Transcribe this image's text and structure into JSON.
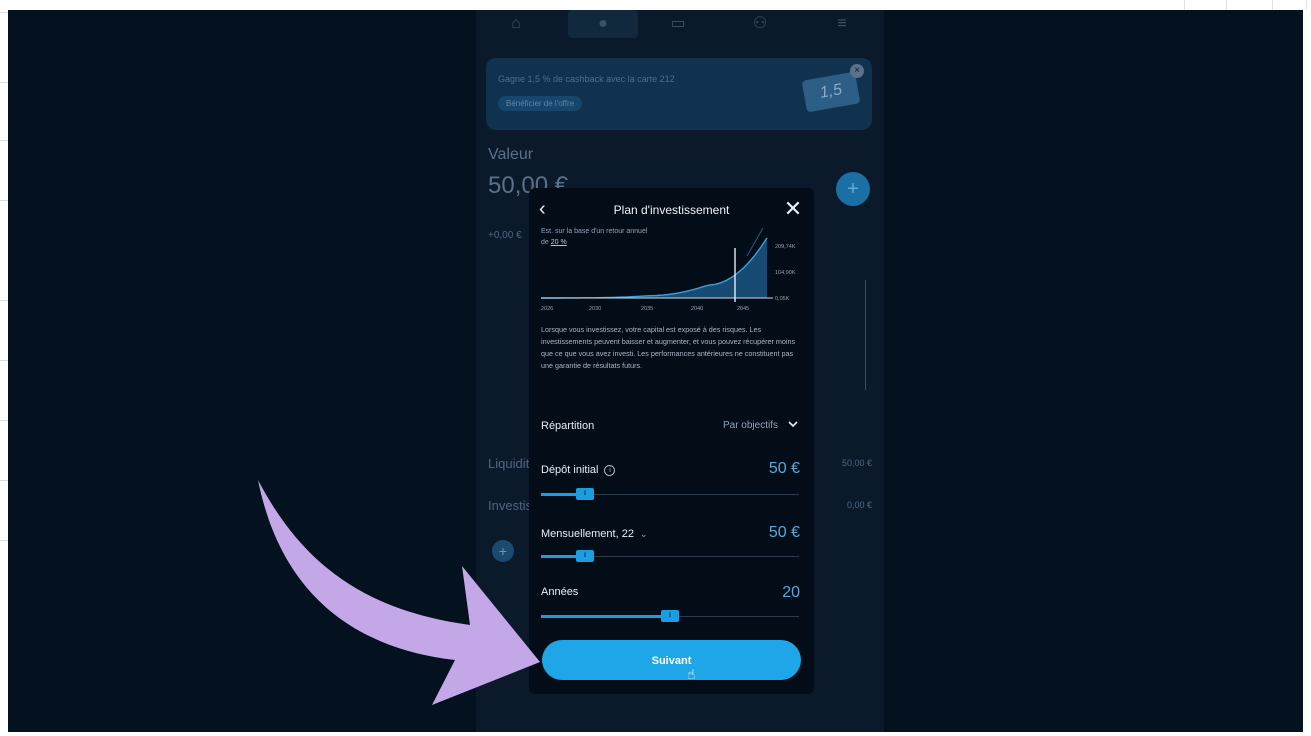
{
  "background_app": {
    "nav_icons": [
      "home-icon",
      "portfolio-icon",
      "card-icon",
      "people-icon",
      "menu-icon"
    ],
    "promo": {
      "text": "Gagne 1,5 % de cashback avec la carte 212",
      "button": "Bénéficier de l'offre",
      "card_text": "1,5",
      "close": "×"
    },
    "valeur_label": "Valeur",
    "valeur_amount": "50,00 €",
    "valeur_change": "+0,00 €",
    "plus": "+",
    "liquidites_label": "Liquidit",
    "liquidites_value": "50,00 €",
    "investis_label": "Investis",
    "investis_value": "0,00 €"
  },
  "modal": {
    "title": "Plan d'investissement",
    "back": "‹",
    "close": "✕",
    "est_text": "Est. sur la base d'un retour annuel",
    "est_rate_prefix": "de",
    "est_rate": "20 %",
    "disclaimer": "Lorsque vous investissez, votre capital est exposé à des risques. Les investissements peuvent baisser et augmenter, et vous pouvez récupérer moins que ce que vous avez investi. Les performances antérieures ne constituent pas une garantie de résultats futurs.",
    "repartition_label": "Répartition",
    "repartition_value": "Par objectifs",
    "depot_label": "Dépôt initial",
    "depot_value": "50 €",
    "mensuel_label": "Mensuellement, 22",
    "mensuel_value": "50 €",
    "annees_label": "Années",
    "annees_value": "20",
    "cta": "Suivant",
    "slider_levels": {
      "depot": 0.17,
      "mensuel": 0.17,
      "annees": 0.5
    },
    "accent_color": "#1fa6e8"
  },
  "chart_data": {
    "type": "area",
    "x": [
      2026,
      2030,
      2035,
      2040,
      2045
    ],
    "series": [
      {
        "values": [
          0.05,
          0.8,
          8,
          45,
          209.74
        ]
      }
    ],
    "x_tick_labels": [
      "2026",
      "2030",
      "2035",
      "2040",
      "2045"
    ],
    "y_tick_labels": [
      "209,74K",
      "104,90K",
      "0,05K"
    ],
    "ylim": [
      0.05,
      209.74
    ],
    "ylabel": "",
    "xlabel": "",
    "title": ""
  },
  "annotation": {
    "arrow_color": "#c4a7e7"
  }
}
